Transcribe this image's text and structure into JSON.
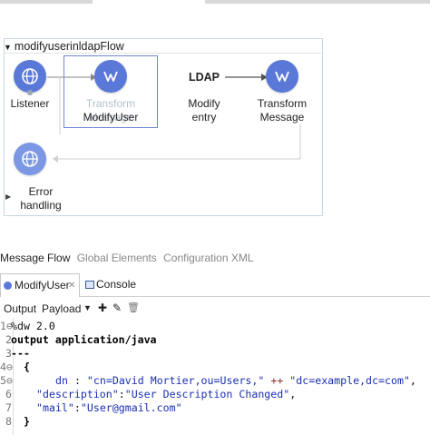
{
  "flow": {
    "name": "modifyuserinldapFlow",
    "listener_label": "Listener",
    "transform1_label_dim": "Transform Message",
    "transform1_label": "ModifyUser",
    "ldap_label": "LDAP",
    "modify_label_1": "Modify",
    "modify_label_2": "entry",
    "transform2_label_1": "Transform",
    "transform2_label_2": "Message",
    "error_label_1": "Error",
    "error_label_2": "handling"
  },
  "bottom_tabs": [
    "Message Flow",
    "Global Elements",
    "Configuration XML"
  ],
  "editor_tabs": {
    "modifyuser": "ModifyUser",
    "console": "Console"
  },
  "toolbar": {
    "output": "Output",
    "payload": "Payload"
  },
  "code": {
    "line_numbers": [
      "1⊖",
      "2",
      "3",
      "4⊖",
      "5⊖",
      "6",
      "7",
      "8"
    ],
    "l1": "%dw 2.0",
    "l2": "output application/java",
    "l3": "---",
    "l4": "{",
    "l5_key": "dn",
    "l5_sep": " : ",
    "l5_str1": "\"cn=David Mortier,ou=Users,\"",
    "l5_op": " ++ ",
    "l5_str2": "\"dc=example,dc=com\"",
    "l5_end": ",",
    "l6_key": "\"description\"",
    "l6_sep": ":",
    "l6_val": "\"User Description Changed\"",
    "l6_end": ",",
    "l7_key": "\"mail\"",
    "l7_sep": ":",
    "l7_val": "\"User@gmail.com\"",
    "l8": "}"
  },
  "colors": {
    "accent": "#5a78d7",
    "selection": "#6f86d6"
  }
}
